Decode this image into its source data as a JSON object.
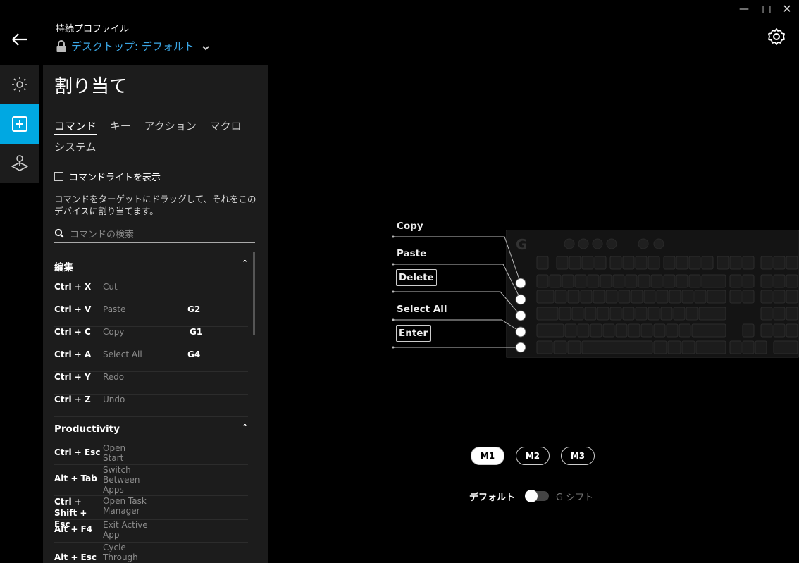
{
  "header": {
    "profile_label": "持続プロファイル",
    "profile_name": "デスクトップ: デフォルト"
  },
  "panel": {
    "title": "割り当て",
    "tabs": [
      "コマンド",
      "キー",
      "アクション",
      "マクロ",
      "システム"
    ],
    "active_tab": "コマンド",
    "checkbox_label": "コマンドライトを表示",
    "description": "コマンドをターゲットにドラッグして、それをこのデバイスに割り当てます。",
    "search_placeholder": "コマンドの検索",
    "sections": [
      {
        "title": "編集",
        "rows": [
          {
            "keys": "Ctrl + X",
            "name": "Cut",
            "assign": ""
          },
          {
            "keys": "Ctrl + V",
            "name": "Paste",
            "assign": "G2"
          },
          {
            "keys": "Ctrl + C",
            "name": "Copy",
            "assign": "G1"
          },
          {
            "keys": "Ctrl + A",
            "name": "Select All",
            "assign": "G4"
          },
          {
            "keys": "Ctrl + Y",
            "name": "Redo",
            "assign": ""
          },
          {
            "keys": "Ctrl + Z",
            "name": "Undo",
            "assign": ""
          }
        ]
      },
      {
        "title": "Productivity",
        "rows": [
          {
            "keys": "Ctrl + Esc",
            "name": "Open Start",
            "assign": ""
          },
          {
            "keys": "Alt + Tab",
            "name": "Switch Between Apps",
            "assign": ""
          },
          {
            "keys": "Ctrl + Shift + Esc",
            "name": "Open Task Manager",
            "assign": ""
          },
          {
            "keys": "Alt + F4",
            "name": "Exit Active App",
            "assign": ""
          },
          {
            "keys": "Alt + Esc",
            "name": "Cycle Through",
            "assign": ""
          }
        ]
      }
    ]
  },
  "keyboard": {
    "callouts": [
      {
        "label": "Copy",
        "boxed": false
      },
      {
        "label": "Paste",
        "boxed": false
      },
      {
        "label": "Delete",
        "boxed": true
      },
      {
        "label": "Select All",
        "boxed": false
      },
      {
        "label": "Enter",
        "boxed": true
      }
    ]
  },
  "modes": {
    "buttons": [
      "M1",
      "M2",
      "M3"
    ],
    "active": "M1"
  },
  "gshift": {
    "left_label": "デフォルト",
    "right_label": "G シフト"
  },
  "colors": {
    "accent": "#00a8e2",
    "profile_text": "#3ba7e6",
    "panel_bg": "#1c1c1c"
  }
}
